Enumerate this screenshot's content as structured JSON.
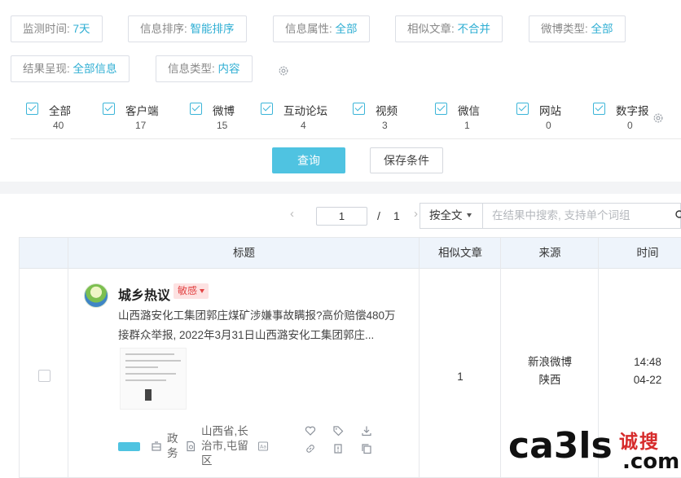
{
  "filters": [
    {
      "label": "监测时间:",
      "value": "7天"
    },
    {
      "label": "信息排序:",
      "value": "智能排序"
    },
    {
      "label": "信息属性:",
      "value": "全部"
    },
    {
      "label": "相似文章:",
      "value": "不合并"
    },
    {
      "label": "微博类型:",
      "value": "全部"
    },
    {
      "label": "结果呈现:",
      "value": "全部信息"
    },
    {
      "label": "信息类型:",
      "value": "内容"
    }
  ],
  "categories": [
    {
      "label": "全部",
      "count": "40",
      "checked": true
    },
    {
      "label": "客户端",
      "count": "17",
      "checked": true
    },
    {
      "label": "微博",
      "count": "15",
      "checked": true
    },
    {
      "label": "互动论坛",
      "count": "4",
      "checked": true
    },
    {
      "label": "视频",
      "count": "3",
      "checked": true
    },
    {
      "label": "微信",
      "count": "1",
      "checked": true
    },
    {
      "label": "网站",
      "count": "0",
      "checked": true
    },
    {
      "label": "数字报",
      "count": "0",
      "checked": true
    }
  ],
  "actions": {
    "query": "查询",
    "save": "保存条件"
  },
  "pager": {
    "current": "1",
    "separator": "/",
    "total": "1"
  },
  "search": {
    "scope": "按全文",
    "placeholder": "在结果中搜索, 支持单个词组"
  },
  "table": {
    "headers": [
      "标题",
      "相似文章",
      "来源",
      "时间"
    ],
    "rows": [
      {
        "author": "城乡热议",
        "tag": "敏感",
        "summary": "山西潞安化工集团郭庄煤矿涉嫌事故瞒报?高价赔偿480万接群众举报, 2022年3月31日山西潞安化工集团郭庄...",
        "category": "政务",
        "location": "山西省,长治市,屯留区",
        "similar": "1",
        "source_name": "新浪微博",
        "source_region": "陕西",
        "time": "14:48",
        "date": "04-22"
      }
    ]
  },
  "watermark": {
    "main": "ca3ls",
    "cn": "诚搜",
    "com": ".com"
  },
  "colors": {
    "accent": "#2eaed3",
    "primary_button": "#4fc3e1",
    "header_bg": "#eef4fb",
    "tag_bg": "#fde2e2",
    "tag_text": "#e24545"
  }
}
